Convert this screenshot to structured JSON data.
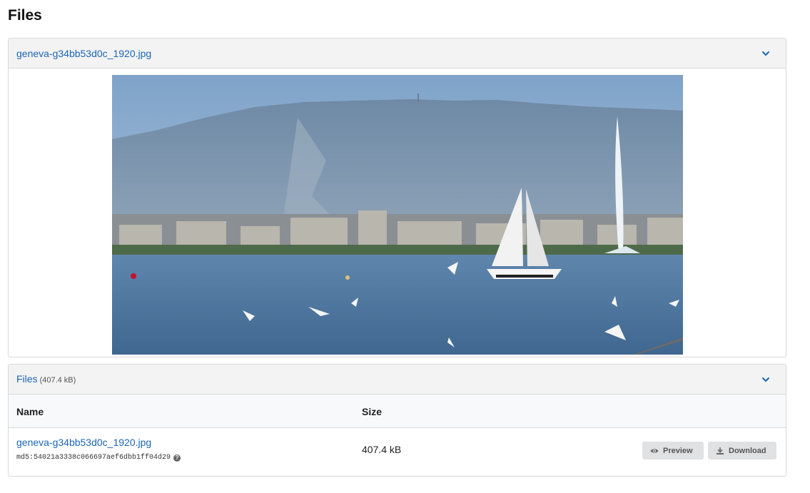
{
  "page": {
    "title": "Files"
  },
  "preview_panel": {
    "filename": "geneva-g34bb53d0c_1920.jpg",
    "toggle_icon": "chevron-down-icon"
  },
  "files_panel": {
    "title": "Files",
    "total_size": "(407.4 kB)",
    "toggle_icon": "chevron-down-icon",
    "columns": {
      "name": "Name",
      "size": "Size"
    },
    "rows": [
      {
        "name": "geneva-g34bb53d0c_1920.jpg",
        "checksum": "md5:54021a3338c066697aef6dbb1ff04d29",
        "size": "407.4 kB",
        "help_icon": "question-circle-icon",
        "preview_label": "Preview",
        "preview_icon": "eye-icon",
        "download_label": "Download",
        "download_icon": "download-icon"
      }
    ]
  },
  "colors": {
    "link": "#1a66b4",
    "panel_header": "#f3f3f3",
    "button": "#e0e1e2"
  }
}
